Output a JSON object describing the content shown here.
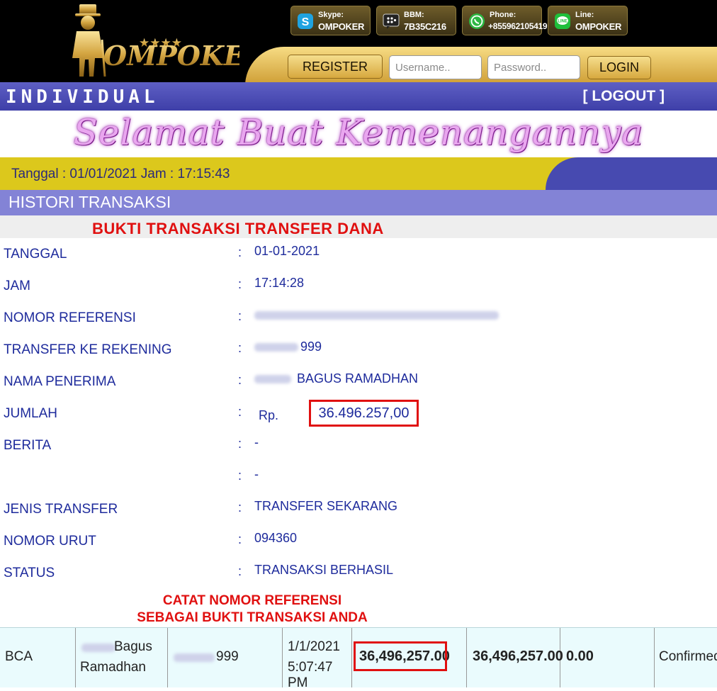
{
  "header": {
    "brand": "OMPOKER",
    "contacts": [
      {
        "icon": "skype-icon",
        "label": "Skype:",
        "value": "OMPOKER"
      },
      {
        "icon": "bbm-icon",
        "label": "BBM:",
        "value": "7B35C216"
      },
      {
        "icon": "whatsapp-icon",
        "label": "Phone:",
        "value": "+855962105419"
      },
      {
        "icon": "line-icon",
        "label": "Line:",
        "value": "OMPOKER"
      }
    ],
    "register_label": "REGISTER",
    "username_placeholder": "Username..",
    "password_placeholder": "Password..",
    "login_label": "LOGIN"
  },
  "account_bar": {
    "title": "INDIVIDUAL",
    "logout_label": "[ LOGOUT ]"
  },
  "banner": {
    "text": "Selamat Buat Kemenangannya"
  },
  "date_bar": {
    "text": "Tanggal : 01/01/2021 Jam : 17:15:43"
  },
  "section": {
    "title": "HISTORI TRANSAKSI"
  },
  "proof": {
    "title": "BUKTI TRANSAKSI TRANSFER DANA",
    "rows": [
      {
        "label": "TANGGAL",
        "value": "01-01-2021"
      },
      {
        "label": "JAM",
        "value": "17:14:28"
      },
      {
        "label": "NOMOR REFERENSI",
        "value": ""
      },
      {
        "label": "TRANSFER KE REKENING",
        "value": "999"
      },
      {
        "label": "NAMA PENERIMA",
        "value": "BAGUS RAMADHAN"
      },
      {
        "label": "JUMLAH",
        "currency": "Rp.",
        "value": "36.496.257,00"
      },
      {
        "label": "BERITA",
        "value": "-"
      },
      {
        "label": "",
        "value": "-"
      },
      {
        "label": "JENIS TRANSFER",
        "value": "TRANSFER SEKARANG"
      },
      {
        "label": "NOMOR URUT",
        "value": "094360"
      },
      {
        "label": "STATUS",
        "value": "TRANSAKSI BERHASIL"
      }
    ],
    "note_line1": "CATAT NOMOR REFERENSI",
    "note_line2": "SEBAGAI BUKTI TRANSAKSI ANDA"
  },
  "transaction": {
    "bank": "BCA",
    "name_line1": "Bagus",
    "name_line2": "Ramadhan",
    "account": "999",
    "date": "1/1/2021",
    "time": "5:07:47 PM",
    "amount": "36,496,257.00",
    "total": "36,496,257.00",
    "fee": "0.00",
    "status": "Confirmed"
  },
  "colors": {
    "accent_blue": "#3e3fa8",
    "highlight_red": "#e01010",
    "gold": "#d7a83e",
    "date_bar_yellow": "#dcc81c"
  }
}
